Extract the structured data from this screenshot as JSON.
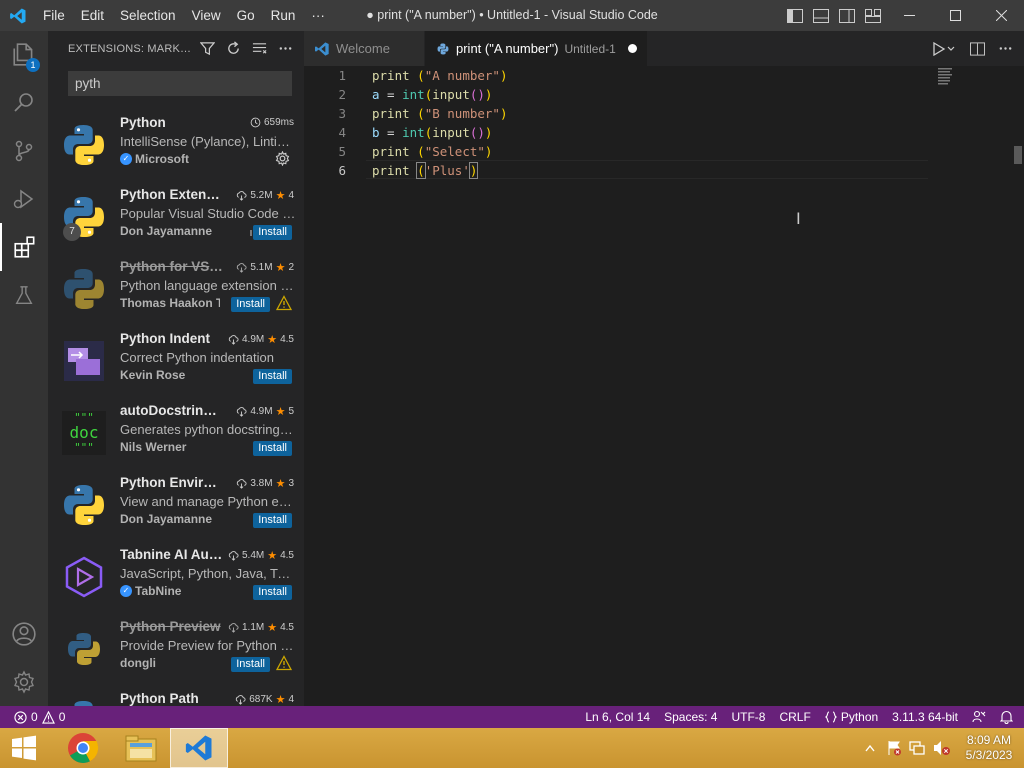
{
  "titlebar": {
    "menu": [
      "File",
      "Edit",
      "Selection",
      "View",
      "Go",
      "Run",
      "···"
    ],
    "window_title": "● print (\"A number\") • Untitled-1 - Visual Studio Code"
  },
  "activitybar": {
    "items": [
      "explorer-icon",
      "search-icon",
      "source-control-icon",
      "run-debug-icon",
      "extensions-icon",
      "testing-icon"
    ],
    "explorer_badge": "1",
    "bottom": [
      "accounts-icon",
      "manage-gear-icon"
    ]
  },
  "sidebar": {
    "title": "EXTENSIONS: MARKETPLACE",
    "search_value": "pyth",
    "extensions": [
      {
        "name": "Python",
        "stat": "659ms",
        "rating": "",
        "desc": "IntelliSense (Pylance), Linting, Debugging",
        "publisher": "Microsoft",
        "verified": true,
        "installed": true,
        "deprecated": false,
        "warning": false,
        "count_badge": ""
      },
      {
        "name": "Python Extension Pack",
        "stat": "5.2M",
        "rating": "4",
        "desc": "Popular Visual Studio Code extensions for Python",
        "publisher": "Don Jayamanne",
        "verified": false,
        "installed": false,
        "deprecated": false,
        "warning": false,
        "count_badge": "7"
      },
      {
        "name": "Python for VSCode",
        "stat": "5.1M",
        "rating": "2",
        "desc": "Python language extension for vscode",
        "publisher": "Thomas Haakon Townsend",
        "verified": false,
        "installed": false,
        "deprecated": true,
        "warning": true,
        "count_badge": ""
      },
      {
        "name": "Python Indent",
        "stat": "4.9M",
        "rating": "4.5",
        "desc": "Correct Python indentation",
        "publisher": "Kevin Rose",
        "verified": false,
        "installed": false,
        "deprecated": false,
        "warning": false,
        "count_badge": ""
      },
      {
        "name": "autoDocstring - Python Docstring Generator",
        "stat": "4.9M",
        "rating": "5",
        "desc": "Generates python docstrings automatically",
        "publisher": "Nils Werner",
        "verified": false,
        "installed": false,
        "deprecated": false,
        "warning": false,
        "count_badge": ""
      },
      {
        "name": "Python Environment Manager",
        "stat": "3.8M",
        "rating": "3",
        "desc": "View and manage Python environments",
        "publisher": "Don Jayamanne",
        "verified": false,
        "installed": false,
        "deprecated": false,
        "warning": false,
        "count_badge": ""
      },
      {
        "name": "Tabnine AI Autocomplete",
        "stat": "5.4M",
        "rating": "4.5",
        "desc": "JavaScript, Python, Java, Typescript & all other languages",
        "publisher": "TabNine",
        "verified": true,
        "installed": false,
        "deprecated": false,
        "warning": false,
        "count_badge": ""
      },
      {
        "name": "Python Preview",
        "stat": "1.1M",
        "rating": "4.5",
        "desc": "Provide Preview for Python Execution",
        "publisher": "dongli",
        "verified": false,
        "installed": false,
        "deprecated": true,
        "warning": true,
        "count_badge": ""
      },
      {
        "name": "Python Path",
        "stat": "687K",
        "rating": "4",
        "desc": "",
        "publisher": "",
        "verified": false,
        "installed": false,
        "deprecated": false,
        "warning": false,
        "count_badge": ""
      }
    ],
    "install_label": "Install",
    "doc_icon_text": "doc",
    "doc_icon_quotes": "\"\"\""
  },
  "tabs": {
    "welcome": "Welcome",
    "active_title": "print (\"A number\")",
    "active_desc": "Untitled-1"
  },
  "editor": {
    "lines": [
      {
        "num": "1",
        "tokens": [
          [
            "t-fn",
            "print"
          ],
          [
            "t-p",
            " "
          ],
          [
            "t-br1",
            "("
          ],
          [
            "t-str",
            "\"A number\""
          ],
          [
            "t-br1",
            ")"
          ]
        ]
      },
      {
        "num": "2",
        "tokens": [
          [
            "t-var",
            "a"
          ],
          [
            "t-p",
            " = "
          ],
          [
            "t-type",
            "int"
          ],
          [
            "t-br1",
            "("
          ],
          [
            "t-fn",
            "input"
          ],
          [
            "t-br2",
            "()"
          ],
          [
            "t-br1",
            ")"
          ]
        ]
      },
      {
        "num": "3",
        "tokens": [
          [
            "t-fn",
            "print"
          ],
          [
            "t-p",
            " "
          ],
          [
            "t-br1",
            "("
          ],
          [
            "t-str",
            "\"B number\""
          ],
          [
            "t-br1",
            ")"
          ]
        ]
      },
      {
        "num": "4",
        "tokens": [
          [
            "t-var",
            "b"
          ],
          [
            "t-p",
            " = "
          ],
          [
            "t-type",
            "int"
          ],
          [
            "t-br1",
            "("
          ],
          [
            "t-fn",
            "input"
          ],
          [
            "t-br2",
            "()"
          ],
          [
            "t-br1",
            ")"
          ]
        ]
      },
      {
        "num": "5",
        "tokens": [
          [
            "t-fn",
            "print"
          ],
          [
            "t-p",
            " "
          ],
          [
            "t-br1",
            "("
          ],
          [
            "t-str",
            "\"Select\""
          ],
          [
            "t-br1",
            ")"
          ]
        ]
      },
      {
        "num": "6",
        "tokens": [
          [
            "t-fn",
            "print"
          ],
          [
            "t-p",
            " "
          ],
          [
            "t-br1 bracket-match",
            "("
          ],
          [
            "t-str",
            "'Plus'"
          ],
          [
            "t-br1 bracket-match",
            ")"
          ]
        ]
      }
    ],
    "current_line": 6
  },
  "statusbar": {
    "errors": "0",
    "warnings": "0",
    "position": "Ln 6, Col 14",
    "spaces": "Spaces: 4",
    "encoding": "UTF-8",
    "eol": "CRLF",
    "language": "Python",
    "interpreter": "3.11.3 64-bit"
  },
  "taskbar": {
    "apps": [
      "chrome-icon",
      "file-explorer-icon",
      "vscode-icon"
    ],
    "time": "8:09 AM",
    "date": "5/3/2023"
  },
  "colors": {
    "statusbar": "#68217a",
    "install": "#0e639c",
    "star": "#ff8e00"
  }
}
